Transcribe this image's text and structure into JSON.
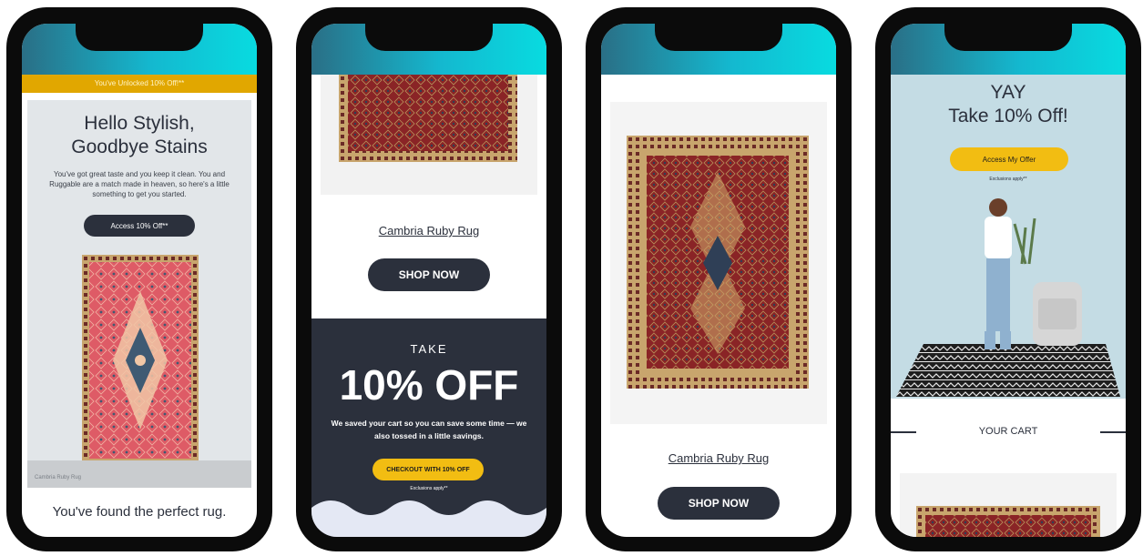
{
  "colors": {
    "dark": "#2b303c",
    "yellow": "#f2bd12",
    "banner_gold": "#e1a700",
    "teal": "#14b8cf",
    "rug_red": "#8c2a2a"
  },
  "phone1": {
    "banner": "You've Unlocked 10% Off!**",
    "headline_line1": "Hello Stylish,",
    "headline_line2": "Goodbye Stains",
    "body": "You've got great taste and you keep it clean. You and Ruggable are a match made in heaven, so here's a little something to get you started.",
    "cta": "Access 10% Off**",
    "caption": "Cambria Ruby Rug",
    "footer": "You've found the perfect rug."
  },
  "phone2": {
    "product_name": "Cambria Ruby Rug",
    "shop_button": "SHOP NOW",
    "take": "TAKE",
    "offer": "10% OFF",
    "body": "We saved your cart so you can save some time — we also tossed in a little savings.",
    "checkout_button": "CHECKOUT WITH 10% OFF",
    "exclusions": "Exclusions apply**"
  },
  "phone3": {
    "product_name": "Cambria Ruby Rug",
    "shop_button": "SHOP NOW"
  },
  "phone4": {
    "headline_line1": "YAY",
    "headline_line2": "Take 10% Off!",
    "cta": "Access My Offer",
    "exclusions": "Exclusions apply**",
    "section_title": "YOUR CART"
  }
}
